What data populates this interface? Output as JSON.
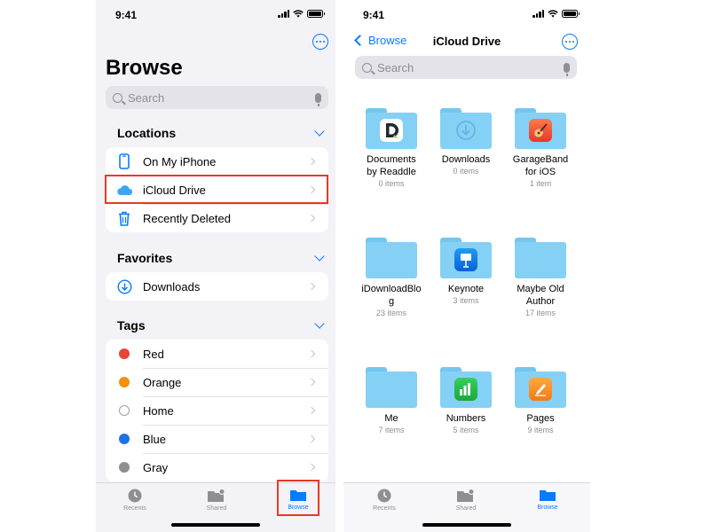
{
  "left": {
    "status": {
      "time": "9:41"
    },
    "title": "Browse",
    "search": {
      "placeholder": "Search"
    },
    "sections": {
      "locations": {
        "title": "Locations",
        "items": [
          {
            "label": "On My iPhone",
            "icon": "iphone-icon"
          },
          {
            "label": "iCloud Drive",
            "icon": "icloud-icon"
          },
          {
            "label": "Recently Deleted",
            "icon": "trash-icon"
          }
        ]
      },
      "favorites": {
        "title": "Favorites",
        "items": [
          {
            "label": "Downloads",
            "icon": "download-circle-icon"
          }
        ]
      },
      "tags": {
        "title": "Tags",
        "items": [
          {
            "label": "Red",
            "color": "#ea4335"
          },
          {
            "label": "Orange",
            "color": "#f4900c"
          },
          {
            "label": "Home",
            "color": "#ffffff"
          },
          {
            "label": "Blue",
            "color": "#1a73e8"
          },
          {
            "label": "Gray",
            "color": "#8e8e93"
          }
        ]
      }
    },
    "tabs": [
      {
        "label": "Recents",
        "active": false
      },
      {
        "label": "Shared",
        "active": false
      },
      {
        "label": "Browse",
        "active": true
      }
    ]
  },
  "right": {
    "status": {
      "time": "9:41"
    },
    "back_label": "Browse",
    "title": "iCloud Drive",
    "search": {
      "placeholder": "Search"
    },
    "folders": [
      {
        "name": "Documents by Readdle",
        "count": "0 items",
        "badge": "readdle-documents-icon"
      },
      {
        "name": "Downloads",
        "count": "0 items",
        "badge": "download-icon"
      },
      {
        "name": "GarageBand for iOS",
        "count": "1 item",
        "badge": "garageband-guitar-icon"
      },
      {
        "name": "iDownloadBlog",
        "count": "23 items",
        "badge": ""
      },
      {
        "name": "Keynote",
        "count": "3 items",
        "badge": "keynote-icon"
      },
      {
        "name": "Maybe Old Author",
        "count": "17 items",
        "badge": ""
      },
      {
        "name": "Me",
        "count": "7 items",
        "badge": ""
      },
      {
        "name": "Numbers",
        "count": "5 items",
        "badge": "numbers-icon"
      },
      {
        "name": "Pages",
        "count": "9 items",
        "badge": "pages-icon"
      }
    ],
    "tabs": [
      {
        "label": "Recents",
        "active": false
      },
      {
        "label": "Shared",
        "active": false
      },
      {
        "label": "Browse",
        "active": true
      }
    ]
  },
  "colors": {
    "accent": "#0a7aff",
    "highlight": "#e63a25"
  }
}
